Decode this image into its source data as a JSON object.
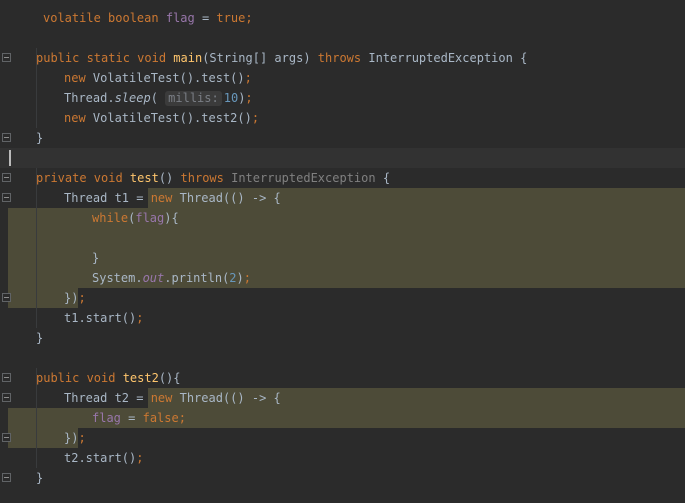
{
  "editor": {
    "lines": [
      {
        "id": "l1",
        "segments": [
          {
            "t": "volatile boolean ",
            "c": "kw"
          },
          {
            "t": "flag",
            "c": "fld"
          },
          {
            "t": " = ",
            "c": ""
          },
          {
            "t": "true",
            "c": "kw"
          },
          {
            "t": ";",
            "c": "kw"
          }
        ]
      },
      {
        "id": "l2",
        "segments": []
      },
      {
        "id": "l3",
        "segments": [
          {
            "t": "public static void ",
            "c": "kw"
          },
          {
            "t": "main",
            "c": "fn"
          },
          {
            "t": "(String[] args) ",
            "c": ""
          },
          {
            "t": "throws ",
            "c": "kw"
          },
          {
            "t": "InterruptedException {",
            "c": ""
          }
        ]
      },
      {
        "id": "l4",
        "segments": [
          {
            "t": "new ",
            "c": "kw"
          },
          {
            "t": "VolatileTest().test()",
            "c": ""
          },
          {
            "t": ";",
            "c": "kw"
          }
        ]
      },
      {
        "id": "l5",
        "segments": [
          {
            "t": "Thread.",
            "c": ""
          },
          {
            "t": "sleep",
            "c": "ital"
          },
          {
            "t": "( ",
            "c": ""
          },
          {
            "t": "millis:",
            "c": "hint"
          },
          {
            "t": "10",
            "c": "num"
          },
          {
            "t": ")",
            "c": ""
          },
          {
            "t": ";",
            "c": "kw"
          }
        ]
      },
      {
        "id": "l6",
        "segments": [
          {
            "t": "new ",
            "c": "kw"
          },
          {
            "t": "VolatileTest().test2()",
            "c": ""
          },
          {
            "t": ";",
            "c": "kw"
          }
        ]
      },
      {
        "id": "l7",
        "segments": [
          {
            "t": "}",
            "c": ""
          }
        ]
      },
      {
        "id": "l8",
        "segments": []
      },
      {
        "id": "l9",
        "segments": [
          {
            "t": "private void ",
            "c": "kw"
          },
          {
            "t": "test",
            "c": "fn"
          },
          {
            "t": "() ",
            "c": ""
          },
          {
            "t": "throws ",
            "c": "kw"
          },
          {
            "t": "InterruptedException",
            "c": "dim"
          },
          {
            "t": " {",
            "c": ""
          }
        ]
      },
      {
        "id": "l10",
        "segments": [
          {
            "t": "Thread t1 = ",
            "c": ""
          },
          {
            "t": "new ",
            "c": "kw"
          },
          {
            "t": "Thread(() -> {",
            "c": ""
          }
        ]
      },
      {
        "id": "l11",
        "segments": [
          {
            "t": "while",
            "c": "kw"
          },
          {
            "t": "(",
            "c": ""
          },
          {
            "t": "flag",
            "c": "fld"
          },
          {
            "t": "){",
            "c": ""
          }
        ]
      },
      {
        "id": "l12",
        "segments": []
      },
      {
        "id": "l13",
        "segments": [
          {
            "t": "}",
            "c": ""
          }
        ]
      },
      {
        "id": "l14",
        "segments": [
          {
            "t": "System.",
            "c": ""
          },
          {
            "t": "out",
            "c": "fld ital"
          },
          {
            "t": ".println(",
            "c": ""
          },
          {
            "t": "2",
            "c": "num"
          },
          {
            "t": ")",
            "c": ""
          },
          {
            "t": ";",
            "c": "kw"
          }
        ]
      },
      {
        "id": "l15",
        "segments": [
          {
            "t": "})",
            "c": ""
          },
          {
            "t": ";",
            "c": "kw"
          }
        ]
      },
      {
        "id": "l16",
        "segments": [
          {
            "t": "t1.start()",
            "c": ""
          },
          {
            "t": ";",
            "c": "kw"
          }
        ]
      },
      {
        "id": "l17",
        "segments": [
          {
            "t": "}",
            "c": ""
          }
        ]
      },
      {
        "id": "l18",
        "segments": []
      },
      {
        "id": "l19",
        "segments": [
          {
            "t": "public void ",
            "c": "kw"
          },
          {
            "t": "test2",
            "c": "fn"
          },
          {
            "t": "(){",
            "c": ""
          }
        ]
      },
      {
        "id": "l20",
        "segments": [
          {
            "t": "Thread t2 = ",
            "c": ""
          },
          {
            "t": "new ",
            "c": "kw"
          },
          {
            "t": "Thread(() -> {",
            "c": ""
          }
        ]
      },
      {
        "id": "l21",
        "segments": [
          {
            "t": "flag",
            "c": "fld"
          },
          {
            "t": " = ",
            "c": ""
          },
          {
            "t": "false",
            "c": "kw"
          },
          {
            "t": ";",
            "c": "kw"
          }
        ]
      },
      {
        "id": "l22",
        "segments": [
          {
            "t": "})",
            "c": ""
          },
          {
            "t": ";",
            "c": "kw"
          }
        ]
      },
      {
        "id": "l23",
        "segments": [
          {
            "t": "t2.start()",
            "c": ""
          },
          {
            "t": ";",
            "c": "kw"
          }
        ]
      },
      {
        "id": "l24",
        "segments": [
          {
            "t": "}",
            "c": ""
          }
        ]
      }
    ]
  },
  "colors": {
    "background": "#2b2b2b",
    "keyword": "#cc7832",
    "field": "#9876aa",
    "method": "#ffc66d",
    "number": "#6897bb",
    "selection_highlight": "#4d4b38"
  }
}
